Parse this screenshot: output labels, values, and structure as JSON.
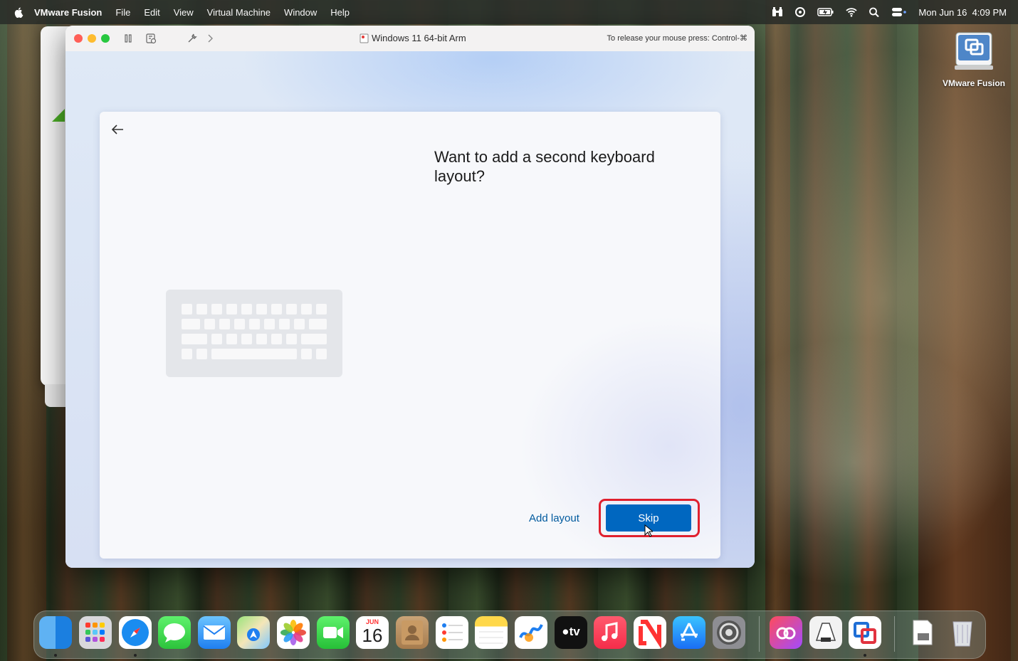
{
  "menubar": {
    "app_name": "VMware Fusion",
    "items": [
      "File",
      "Edit",
      "View",
      "Virtual Machine",
      "Window",
      "Help"
    ],
    "clock": "Mon Jun 16  4:09 PM",
    "status_icons": [
      "binoculars-icon",
      "vpn-icon",
      "battery-icon",
      "wifi-icon",
      "spotlight-search-icon",
      "control-center-icon"
    ]
  },
  "vm_window": {
    "title": "Windows 11 64-bit Arm",
    "release_hint": "To release your mouse press: Control-⌘"
  },
  "oobe": {
    "heading": "Want to add a second keyboard layout?",
    "add_layout_label": "Add layout",
    "skip_label": "Skip"
  },
  "desktop": {
    "icon_label": "VMware Fusion"
  },
  "dock": {
    "calendar_month": "JUN",
    "calendar_day": "16",
    "tv_label": "tv",
    "apps": [
      "finder",
      "launchpad",
      "safari",
      "messages",
      "mail",
      "maps",
      "photos",
      "facetime",
      "calendar",
      "contacts",
      "reminders",
      "notes",
      "freeform",
      "apple-tv",
      "music",
      "news",
      "app-store",
      "system-settings",
      "creative-cloud",
      "preview-scanner",
      "vmware-fusion",
      "downloads",
      "trash"
    ]
  }
}
